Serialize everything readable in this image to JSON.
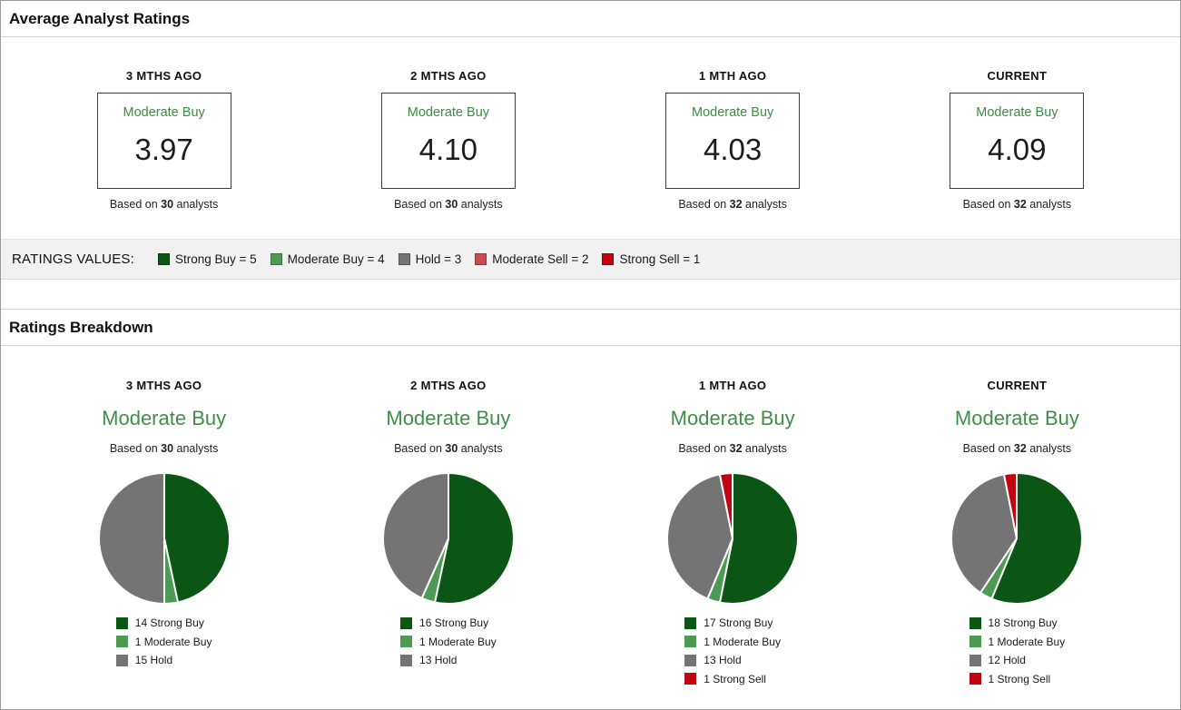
{
  "colors": {
    "strong_buy": "#0b5615",
    "moderate_buy": "#4c9a53",
    "hold": "#747474",
    "moderate_sell": "#ca4a4f",
    "strong_sell": "#c10511",
    "consensus_green": "#3d8b40"
  },
  "sections": {
    "average": {
      "title": "Average Analyst Ratings",
      "columns": [
        {
          "period": "3 MTHS AGO",
          "consensus": "Moderate Buy",
          "value": "3.97",
          "based_prefix": "Based on ",
          "analysts": "30",
          "based_suffix": " analysts"
        },
        {
          "period": "2 MTHS AGO",
          "consensus": "Moderate Buy",
          "value": "4.10",
          "based_prefix": "Based on ",
          "analysts": "30",
          "based_suffix": " analysts"
        },
        {
          "period": "1 MTH AGO",
          "consensus": "Moderate Buy",
          "value": "4.03",
          "based_prefix": "Based on ",
          "analysts": "32",
          "based_suffix": " analysts"
        },
        {
          "period": "CURRENT",
          "consensus": "Moderate Buy",
          "value": "4.09",
          "based_prefix": "Based on ",
          "analysts": "32",
          "based_suffix": " analysts"
        }
      ]
    },
    "ratings_values": {
      "label": "RATINGS VALUES:",
      "items": [
        {
          "label": "Strong Buy = 5",
          "color_key": "strong_buy"
        },
        {
          "label": "Moderate Buy = 4",
          "color_key": "moderate_buy"
        },
        {
          "label": "Hold = 3",
          "color_key": "hold"
        },
        {
          "label": "Moderate Sell = 2",
          "color_key": "moderate_sell"
        },
        {
          "label": "Strong Sell = 1",
          "color_key": "strong_sell"
        }
      ]
    },
    "breakdown": {
      "title": "Ratings Breakdown"
    }
  },
  "chart_data": [
    {
      "type": "pie",
      "title": "3 MTHS AGO",
      "consensus": "Moderate Buy",
      "based_prefix": "Based on ",
      "analysts": "30",
      "based_suffix": " analysts",
      "start_angle_deg": 0,
      "direction": "clockwise",
      "slices": [
        {
          "label": "Strong Buy",
          "count": 14,
          "color_key": "strong_buy"
        },
        {
          "label": "Moderate Buy",
          "count": 1,
          "color_key": "moderate_buy"
        },
        {
          "label": "Hold",
          "count": 15,
          "color_key": "hold"
        }
      ]
    },
    {
      "type": "pie",
      "title": "2 MTHS AGO",
      "consensus": "Moderate Buy",
      "based_prefix": "Based on ",
      "analysts": "30",
      "based_suffix": " analysts",
      "start_angle_deg": 0,
      "direction": "clockwise",
      "slices": [
        {
          "label": "Strong Buy",
          "count": 16,
          "color_key": "strong_buy"
        },
        {
          "label": "Moderate Buy",
          "count": 1,
          "color_key": "moderate_buy"
        },
        {
          "label": "Hold",
          "count": 13,
          "color_key": "hold"
        }
      ]
    },
    {
      "type": "pie",
      "title": "1 MTH AGO",
      "consensus": "Moderate Buy",
      "based_prefix": "Based on ",
      "analysts": "32",
      "based_suffix": " analysts",
      "start_angle_deg": 0,
      "direction": "clockwise",
      "slices": [
        {
          "label": "Strong Buy",
          "count": 17,
          "color_key": "strong_buy"
        },
        {
          "label": "Moderate Buy",
          "count": 1,
          "color_key": "moderate_buy"
        },
        {
          "label": "Hold",
          "count": 13,
          "color_key": "hold"
        },
        {
          "label": "Strong Sell",
          "count": 1,
          "color_key": "strong_sell"
        }
      ]
    },
    {
      "type": "pie",
      "title": "CURRENT",
      "consensus": "Moderate Buy",
      "based_prefix": "Based on ",
      "analysts": "32",
      "based_suffix": " analysts",
      "start_angle_deg": 0,
      "direction": "clockwise",
      "slices": [
        {
          "label": "Strong Buy",
          "count": 18,
          "color_key": "strong_buy"
        },
        {
          "label": "Moderate Buy",
          "count": 1,
          "color_key": "moderate_buy"
        },
        {
          "label": "Hold",
          "count": 12,
          "color_key": "hold"
        },
        {
          "label": "Strong Sell",
          "count": 1,
          "color_key": "strong_sell"
        }
      ]
    }
  ]
}
